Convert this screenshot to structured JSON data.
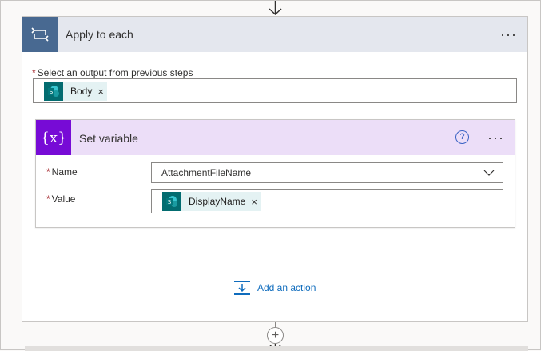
{
  "loop_action": {
    "title": "Apply to each",
    "field_label": "Select an output from previous steps",
    "token_label": "Body",
    "more_label": "···"
  },
  "set_variable": {
    "title": "Set variable",
    "icon_glyph": "{x}",
    "help_glyph": "?",
    "more_label": "···",
    "name_label": "Name",
    "name_value": "AttachmentFileName",
    "value_label": "Value",
    "value_token": "DisplayName"
  },
  "add_action": {
    "label": "Add an action"
  },
  "common": {
    "required_mark": "*",
    "remove_glyph": "×",
    "insert_glyph": "+"
  },
  "colors": {
    "loop_accent": "#486991",
    "variable_accent": "#770bd6",
    "sharepoint": "#036c70",
    "link": "#0f6cbd"
  }
}
